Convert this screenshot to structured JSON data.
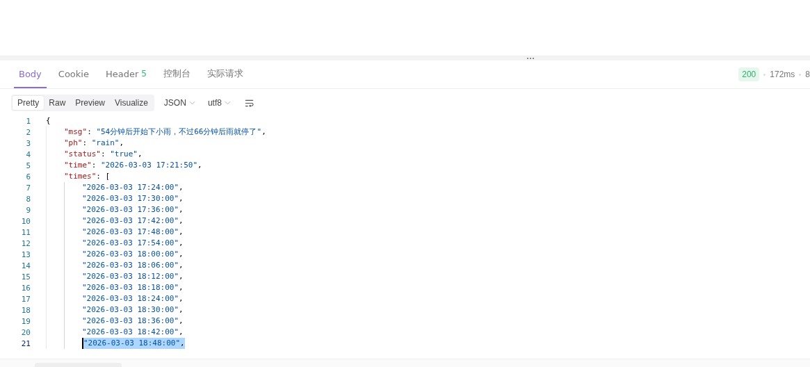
{
  "tabs": [
    {
      "label": "Body",
      "selected": true
    },
    {
      "label": "Cookie",
      "selected": false
    },
    {
      "label": "Header",
      "count": "5",
      "selected": false
    },
    {
      "label": "控制台",
      "selected": false
    },
    {
      "label": "实际请求",
      "selected": false
    }
  ],
  "status": {
    "code": "200",
    "time": "172ms",
    "size": "8"
  },
  "view_modes": [
    {
      "label": "Pretty",
      "selected": true
    },
    {
      "label": "Raw",
      "selected": false
    },
    {
      "label": "Preview",
      "selected": false
    },
    {
      "label": "Visualize",
      "selected": false
    }
  ],
  "format_dropdown": "JSON",
  "encoding_dropdown": "utf8",
  "code": [
    {
      "number": "1",
      "tokens": [
        {
          "kind": "punct",
          "text": "{"
        }
      ],
      "children": [
        {
          "number": "2",
          "tokens": [
            {
              "kind": "key",
              "text": "\"msg\""
            },
            {
              "kind": "punct",
              "text": ": "
            },
            {
              "kind": "string",
              "text": "\"54分钟后开始下小雨，不过66分钟后雨就停了\""
            },
            {
              "kind": "punct",
              "text": ","
            }
          ]
        },
        {
          "number": "3",
          "tokens": [
            {
              "kind": "key",
              "text": "\"ph\""
            },
            {
              "kind": "punct",
              "text": ": "
            },
            {
              "kind": "string",
              "text": "\"rain\""
            },
            {
              "kind": "punct",
              "text": ","
            }
          ]
        },
        {
          "number": "4",
          "tokens": [
            {
              "kind": "key",
              "text": "\"status\""
            },
            {
              "kind": "punct",
              "text": ": "
            },
            {
              "kind": "string",
              "text": "\"true\""
            },
            {
              "kind": "punct",
              "text": ","
            }
          ]
        },
        {
          "number": "5",
          "tokens": [
            {
              "kind": "key",
              "text": "\"time\""
            },
            {
              "kind": "punct",
              "text": ": "
            },
            {
              "kind": "string",
              "text": "\"2026-03-03 17:21:50\""
            },
            {
              "kind": "punct",
              "text": ","
            }
          ]
        },
        {
          "number": "6",
          "tokens": [
            {
              "kind": "key",
              "text": "\"times\""
            },
            {
              "kind": "punct",
              "text": ": ["
            }
          ],
          "children": [
            {
              "number": "7",
              "tokens": [
                {
                  "kind": "string",
                  "text": "\"2026-03-03 17:24:00\""
                },
                {
                  "kind": "punct",
                  "text": ","
                }
              ]
            },
            {
              "number": "8",
              "tokens": [
                {
                  "kind": "string",
                  "text": "\"2026-03-03 17:30:00\""
                },
                {
                  "kind": "punct",
                  "text": ","
                }
              ]
            },
            {
              "number": "9",
              "tokens": [
                {
                  "kind": "string",
                  "text": "\"2026-03-03 17:36:00\""
                },
                {
                  "kind": "punct",
                  "text": ","
                }
              ]
            },
            {
              "number": "10",
              "tokens": [
                {
                  "kind": "string",
                  "text": "\"2026-03-03 17:42:00\""
                },
                {
                  "kind": "punct",
                  "text": ","
                }
              ]
            },
            {
              "number": "11",
              "tokens": [
                {
                  "kind": "string",
                  "text": "\"2026-03-03 17:48:00\""
                },
                {
                  "kind": "punct",
                  "text": ","
                }
              ]
            },
            {
              "number": "12",
              "tokens": [
                {
                  "kind": "string",
                  "text": "\"2026-03-03 17:54:00\""
                },
                {
                  "kind": "punct",
                  "text": ","
                }
              ]
            },
            {
              "number": "13",
              "tokens": [
                {
                  "kind": "string",
                  "text": "\"2026-03-03 18:00:00\""
                },
                {
                  "kind": "punct",
                  "text": ","
                }
              ]
            },
            {
              "number": "14",
              "tokens": [
                {
                  "kind": "string",
                  "text": "\"2026-03-03 18:06:00\""
                },
                {
                  "kind": "punct",
                  "text": ","
                }
              ]
            },
            {
              "number": "15",
              "tokens": [
                {
                  "kind": "string",
                  "text": "\"2026-03-03 18:12:00\""
                },
                {
                  "kind": "punct",
                  "text": ","
                }
              ]
            },
            {
              "number": "16",
              "tokens": [
                {
                  "kind": "string",
                  "text": "\"2026-03-03 18:18:00\""
                },
                {
                  "kind": "punct",
                  "text": ","
                }
              ]
            },
            {
              "number": "17",
              "tokens": [
                {
                  "kind": "string",
                  "text": "\"2026-03-03 18:24:00\""
                },
                {
                  "kind": "punct",
                  "text": ","
                }
              ]
            },
            {
              "number": "18",
              "tokens": [
                {
                  "kind": "string",
                  "text": "\"2026-03-03 18:30:00\""
                },
                {
                  "kind": "punct",
                  "text": ","
                }
              ]
            },
            {
              "number": "19",
              "tokens": [
                {
                  "kind": "string",
                  "text": "\"2026-03-03 18:36:00\""
                },
                {
                  "kind": "punct",
                  "text": ","
                }
              ]
            },
            {
              "number": "20",
              "tokens": [
                {
                  "kind": "string",
                  "text": "\"2026-03-03 18:42:00\""
                },
                {
                  "kind": "punct",
                  "text": ","
                }
              ]
            },
            {
              "number": "21",
              "selected": true,
              "tokens": [
                {
                  "kind": "string",
                  "text": "\"2026-03-03 18:48:00\""
                },
                {
                  "kind": "punct",
                  "text": ","
                }
              ]
            }
          ]
        }
      ]
    }
  ]
}
